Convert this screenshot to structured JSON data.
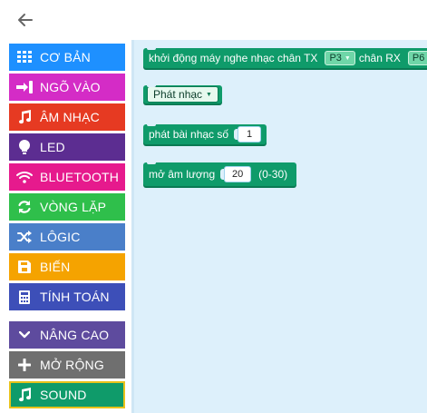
{
  "back": {
    "icon": "arrow-left-icon"
  },
  "sidebar": {
    "items": [
      {
        "label": "CƠ BẢN",
        "icon": "grid-icon",
        "color": "#1e90ff"
      },
      {
        "label": "NGÕ VÀO",
        "icon": "input-icon",
        "color": "#d42cc6"
      },
      {
        "label": "ÂM NHẠC",
        "icon": "music-icon",
        "color": "#e63a22"
      },
      {
        "label": "LED",
        "icon": "bulb-icon",
        "color": "#5c2d91"
      },
      {
        "label": "BLUETOOTH",
        "icon": "wifi-icon",
        "color": "#e61a8d"
      },
      {
        "label": "VÒNG LẶP",
        "icon": "refresh-icon",
        "color": "#2fbf4b"
      },
      {
        "label": "LÔGIC",
        "icon": "shuffle-icon",
        "color": "#4a7fc9"
      },
      {
        "label": "BIẾN",
        "icon": "save-icon",
        "color": "#f5a300"
      },
      {
        "label": "TÍNH TOÁN",
        "icon": "calculator-icon",
        "color": "#7a2cbf"
      },
      {
        "label": "NÂNG CAO",
        "icon": "chevron-down-icon",
        "color": "#5e4b9e"
      },
      {
        "label": "MỞ RỘNG",
        "icon": "plus-icon",
        "color": "#6f6f6f"
      },
      {
        "label": "SOUND",
        "icon": "music-icon",
        "color": "#0f9b6a"
      }
    ]
  },
  "workspace": {
    "block_init": {
      "text1": "khởi động máy nghe nhạc chân TX",
      "tx": "P3",
      "text2": "chân RX",
      "rx": "P6"
    },
    "block_play": {
      "option": "Phát nhạc"
    },
    "block_track": {
      "text": "phát bài nhạc số",
      "value": "1"
    },
    "block_volume": {
      "text": "mở âm lượng",
      "value": "20",
      "range": "(0-30)"
    }
  }
}
